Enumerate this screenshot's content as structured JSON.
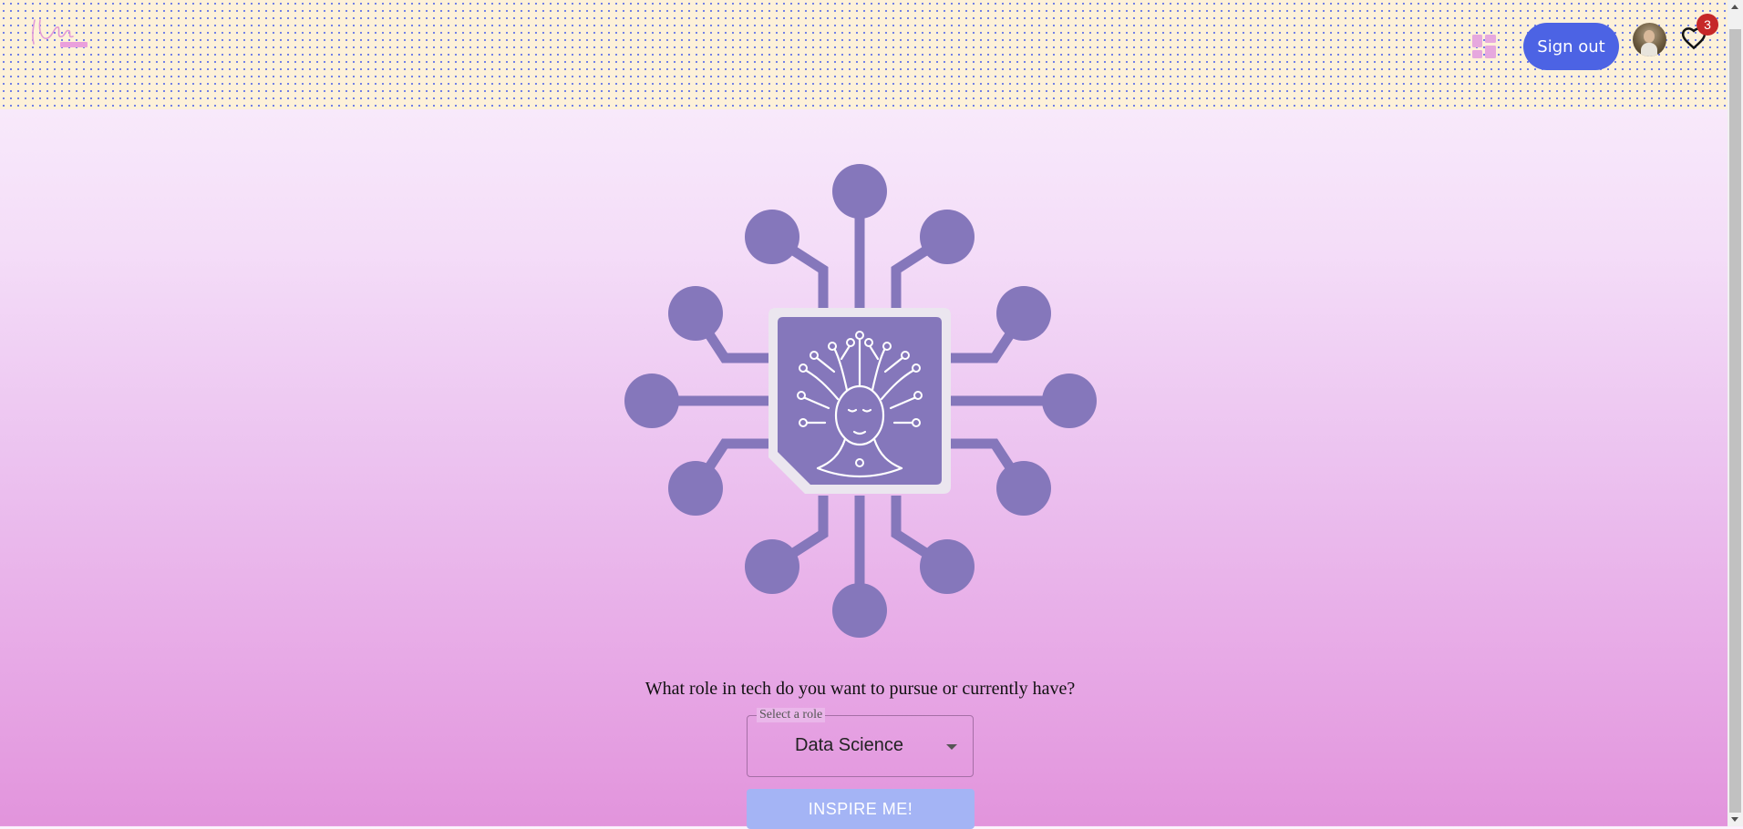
{
  "header": {
    "logo_icon": "signature-logo",
    "dashboard_icon": "dashboard-grid-icon",
    "sign_out_label": "Sign out",
    "avatar_icon": "user-avatar",
    "favorites_icon": "heart-icon",
    "favorites_count": "3"
  },
  "hero": {
    "illustration_icon": "ai-brain-circuit-icon",
    "accent_color": "#8577bb"
  },
  "role_form": {
    "question": "What role in tech do you want to pursue or currently have?",
    "select_label": "Select a role",
    "selected_role": "Data Science",
    "submit_label": "INSPIRE ME!"
  },
  "colors": {
    "sign_out_bg": "#4c63e4",
    "inspire_bg": "#a4b4f5",
    "badge_bg": "#c62828"
  }
}
